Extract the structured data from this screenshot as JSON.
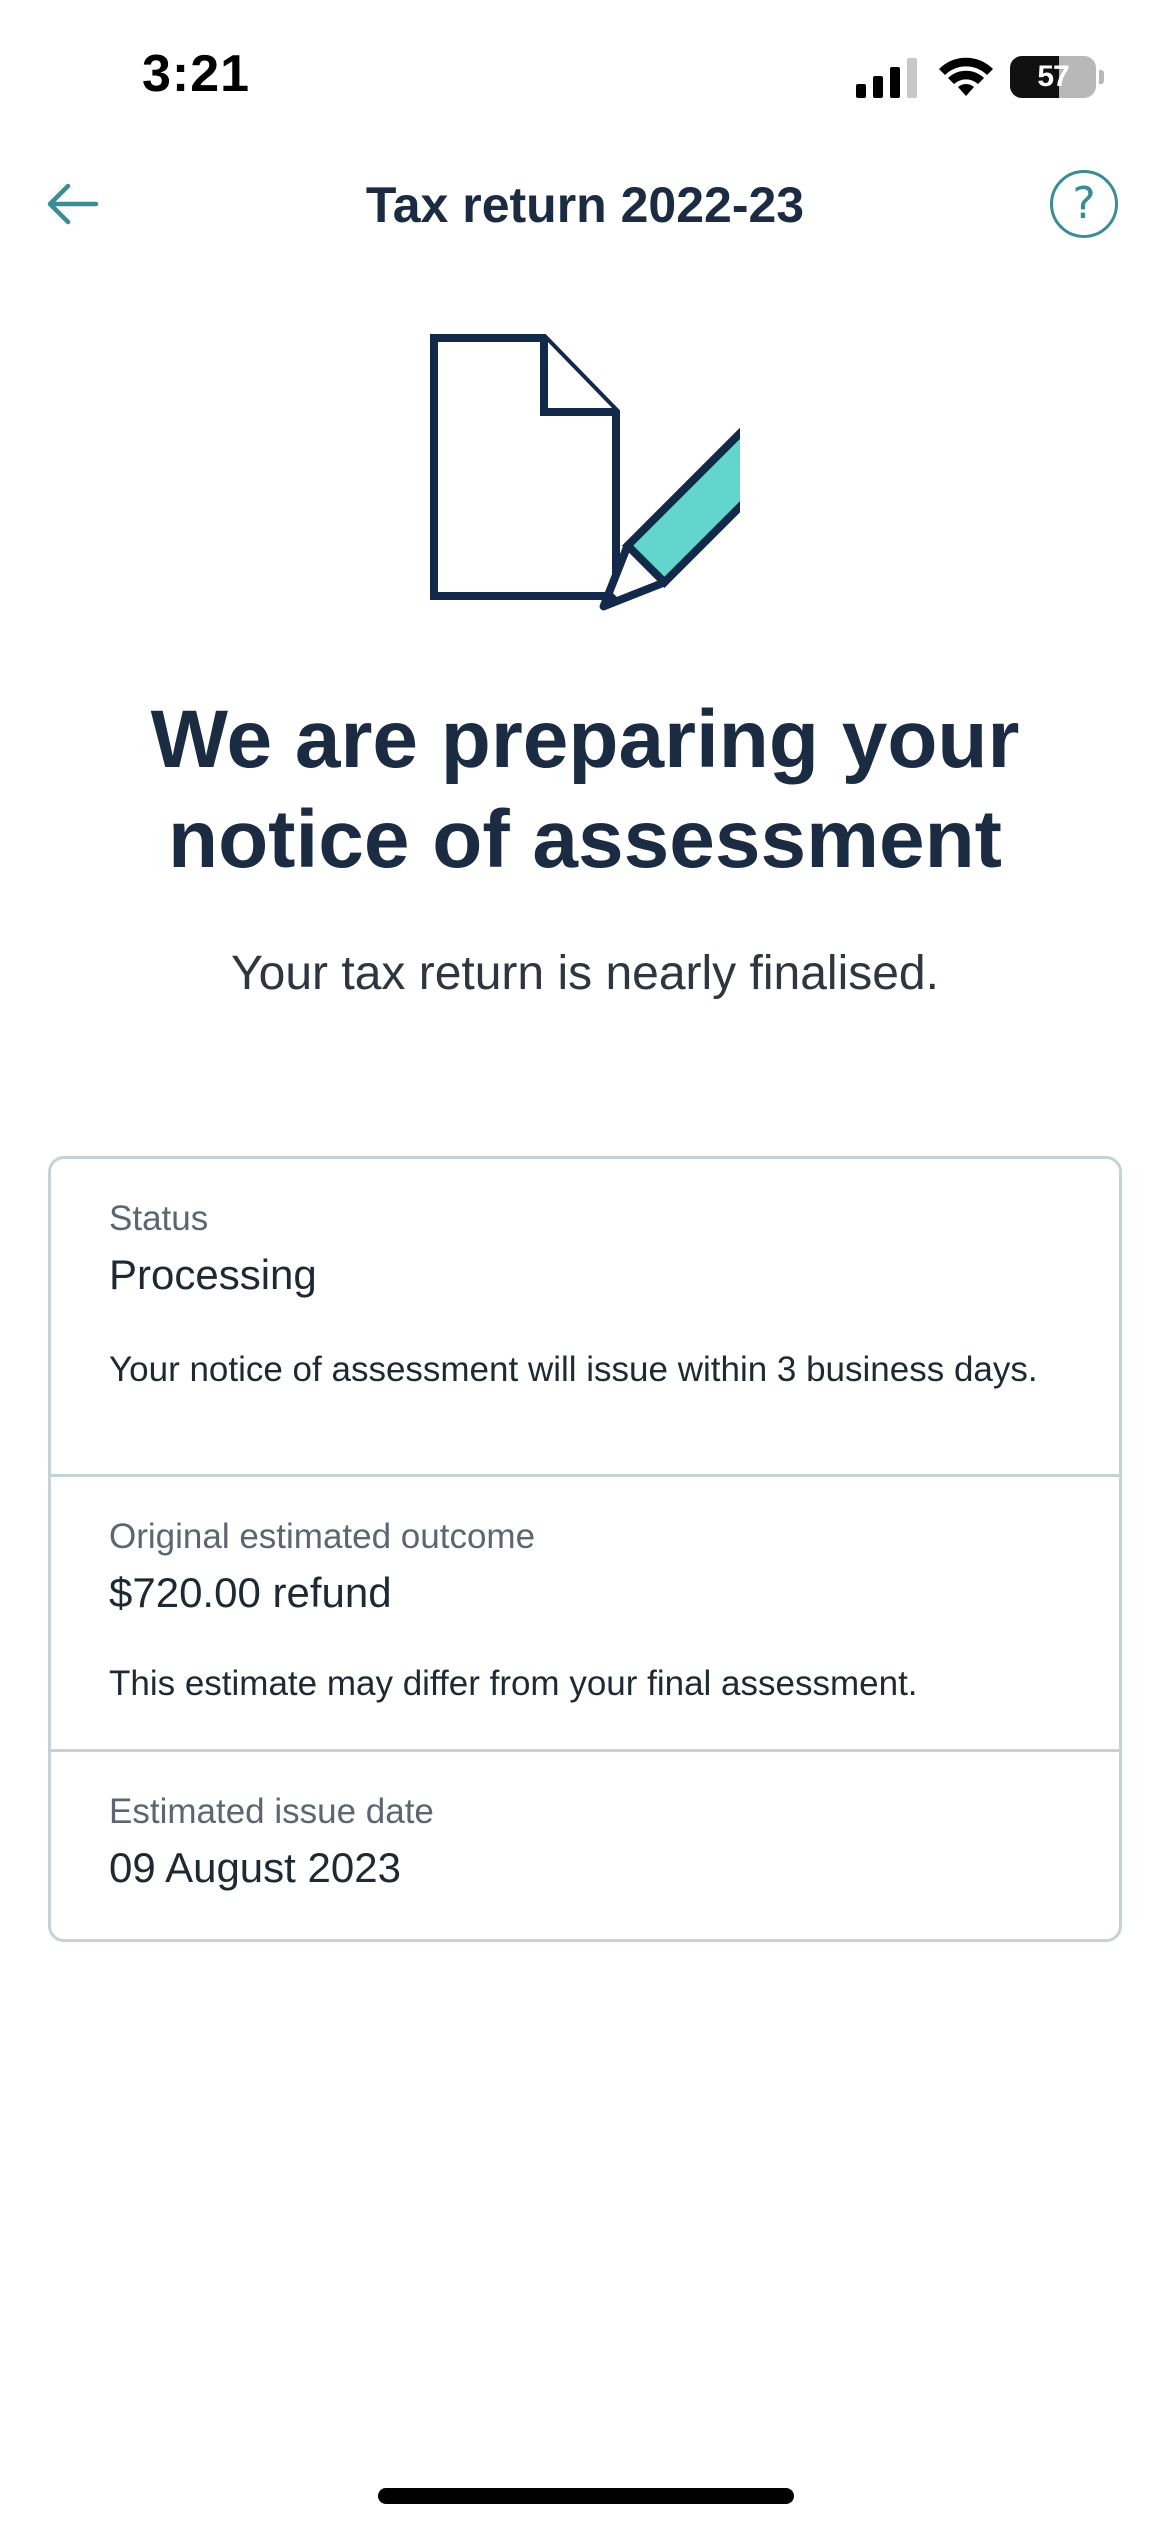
{
  "status_bar": {
    "time": "3:21",
    "battery_level": "57",
    "battery_percent": 57
  },
  "nav": {
    "title": "Tax return 2022-23",
    "back_icon": "arrow-left-icon",
    "help_icon": "question-circle-icon",
    "help_glyph": "?"
  },
  "colors": {
    "accent_teal": "#3b8c94",
    "heading_navy": "#1b2b42",
    "pencil_teal": "#62d6cc",
    "border": "#c4d3d8"
  },
  "main": {
    "headline": "We are preparing your notice of assessment",
    "subheading": "Your tax return is nearly finalised."
  },
  "details": {
    "status": {
      "label": "Status",
      "value": "Processing",
      "description": "Your notice of assessment will issue within 3 business days."
    },
    "outcome": {
      "label": "Original estimated outcome",
      "value": "$720.00 refund",
      "description": "This estimate may differ from your final assessment."
    },
    "issue_date": {
      "label": "Estimated issue date",
      "value": "09 August 2023"
    }
  }
}
